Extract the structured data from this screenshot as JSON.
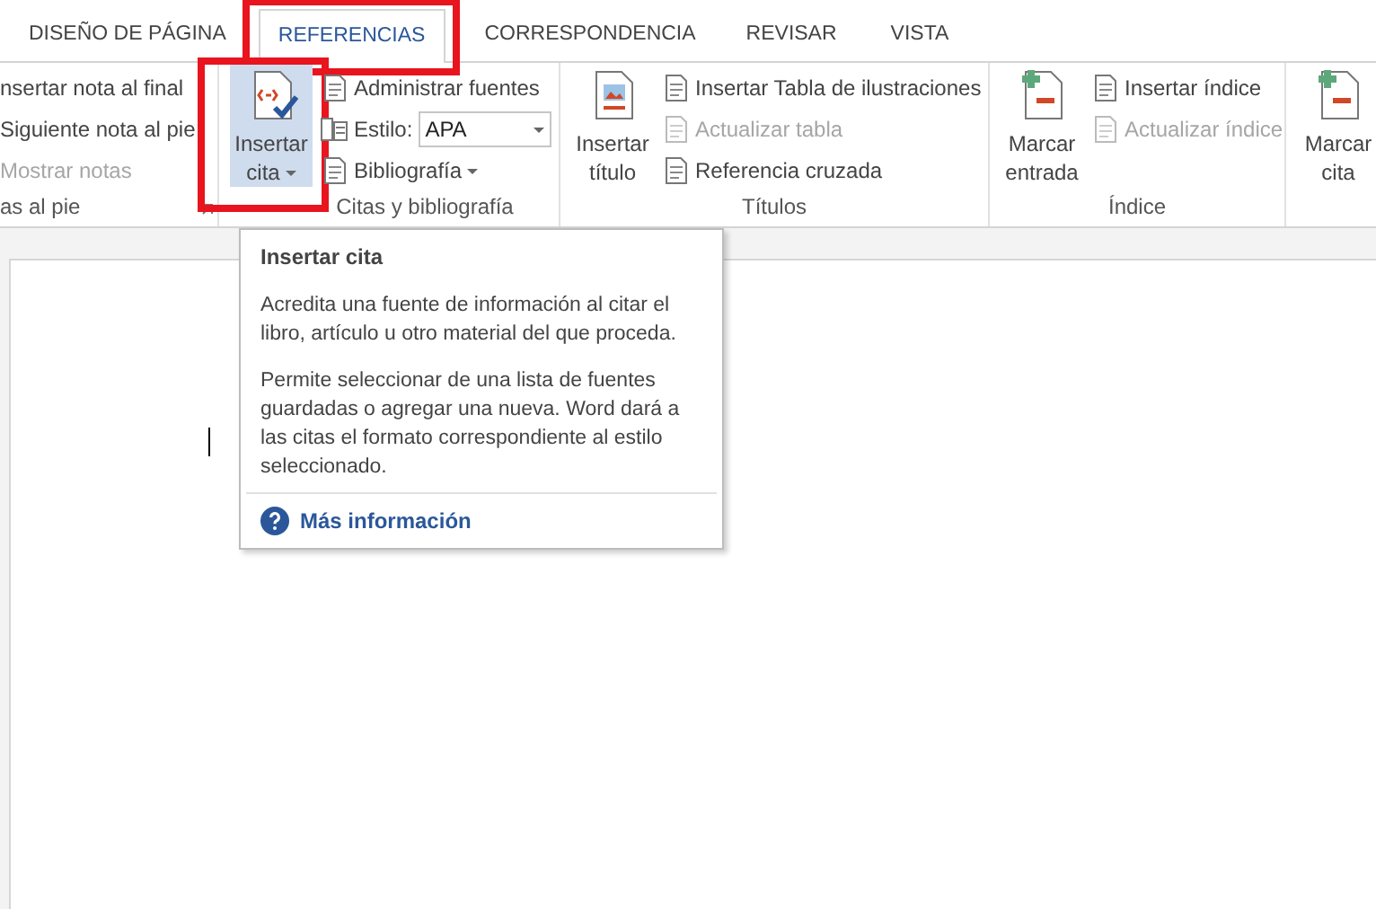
{
  "tabs": [
    {
      "label": "DISEÑO DE PÁGINA",
      "selected": false,
      "highlighted": false
    },
    {
      "label": "REFERENCIAS",
      "selected": true,
      "highlighted": true
    },
    {
      "label": "CORRESPONDENCIA",
      "selected": false,
      "highlighted": false
    },
    {
      "label": "REVISAR",
      "selected": false,
      "highlighted": false
    },
    {
      "label": "VISTA",
      "selected": false,
      "highlighted": false
    }
  ],
  "groups": [
    {
      "label": "as al pie",
      "launcher": true,
      "items": [
        {
          "kind": "text",
          "label": "nsertar nota al final",
          "disabled": false,
          "highlighted": false
        },
        {
          "kind": "text",
          "label": "Siguiente nota al pie",
          "disabled": false,
          "highlighted": false
        },
        {
          "kind": "text",
          "label": "Mostrar notas",
          "disabled": true,
          "highlighted": false
        }
      ]
    },
    {
      "label": "Citas y bibliografía",
      "launcher": false,
      "items": [
        {
          "kind": "large-menu",
          "label": "Insertar cita",
          "disabled": false,
          "highlighted": true
        },
        {
          "kind": "small",
          "label": "Administrar fuentes",
          "disabled": false,
          "highlighted": false
        },
        {
          "kind": "combo",
          "label": "Estilo:",
          "value": "APA",
          "disabled": false,
          "highlighted": false
        },
        {
          "kind": "small-menu",
          "label": "Bibliografía",
          "disabled": false,
          "highlighted": false
        }
      ]
    },
    {
      "label": "Títulos",
      "launcher": false,
      "items": [
        {
          "kind": "large",
          "label": "Insertar título",
          "disabled": false,
          "highlighted": false
        },
        {
          "kind": "small",
          "label": "Insertar Tabla de ilustraciones",
          "disabled": false,
          "highlighted": false
        },
        {
          "kind": "small",
          "label": "Actualizar tabla",
          "disabled": true,
          "highlighted": false
        },
        {
          "kind": "small",
          "label": "Referencia cruzada",
          "disabled": false,
          "highlighted": false
        }
      ]
    },
    {
      "label": "Índice",
      "launcher": false,
      "items": [
        {
          "kind": "large",
          "label": "Marcar entrada",
          "disabled": false,
          "highlighted": false
        },
        {
          "kind": "small",
          "label": "Insertar índice",
          "disabled": false,
          "highlighted": false
        },
        {
          "kind": "small",
          "label": "Actualizar índice",
          "disabled": true,
          "highlighted": false
        }
      ]
    },
    {
      "launcher": false,
      "items": [
        {
          "kind": "large",
          "label": "Marcar cita",
          "disabled": false,
          "highlighted": false
        }
      ]
    }
  ],
  "tooltip": {
    "title": "Insertar cita",
    "paragraphs": [
      "Acredita una fuente de información al citar el libro, artículo u otro material del que proceda.",
      "Permite seleccionar de una lista de fuentes guardadas o agregar una nueva. Word dará a las citas el formato correspondiente al estilo seleccionado."
    ],
    "link": "Más información"
  }
}
